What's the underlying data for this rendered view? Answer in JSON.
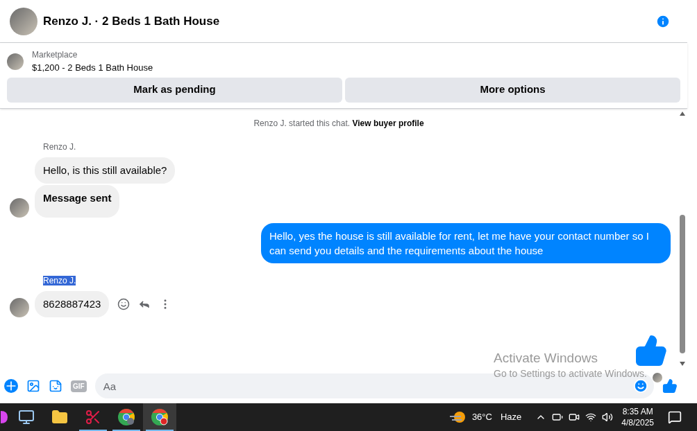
{
  "header": {
    "title": "Renzo J. · 2 Beds 1 Bath House"
  },
  "listing": {
    "source": "Marketplace",
    "title": "$1,200 - 2 Beds 1 Bath House",
    "buttons": [
      "Mark as pending",
      "More options"
    ]
  },
  "notice": {
    "text": "Renzo J. started this chat.",
    "link": "View buyer profile"
  },
  "messages": [
    {
      "kind": "incoming",
      "sender": "Renzo J.",
      "sender_selected": false,
      "texts": [
        "Hello, is this still available?",
        "Message sent"
      ],
      "actions": false
    },
    {
      "kind": "outgoing",
      "texts": [
        "Hello, yes the house is still available for rent, let me have your contact number so I can send you details and the requirements about the house"
      ]
    },
    {
      "kind": "incoming",
      "sender": "Renzo J.",
      "sender_selected": true,
      "texts": [
        "8628887423"
      ],
      "actions": true
    },
    {
      "kind": "like",
      "read": true
    }
  ],
  "composer": {
    "gif": "GIF",
    "placeholder": "Aa"
  },
  "overlay": {
    "title": "Activate Windows",
    "subtitle": "Go to Settings to activate Windows."
  },
  "taskbar": {
    "apps": [
      {
        "kind": "copilot",
        "running": false,
        "active": false
      },
      {
        "kind": "computer",
        "running": false,
        "active": false
      },
      {
        "kind": "folder",
        "running": false,
        "active": false
      },
      {
        "kind": "snip",
        "running": true,
        "active": false
      },
      {
        "kind": "chrome",
        "running": true,
        "active": false
      },
      {
        "kind": "chrome",
        "running": true,
        "active": true
      }
    ],
    "weather": {
      "temp": "36°C",
      "condition": "Haze"
    },
    "time": "8:35 AM",
    "date": "4/8/2025"
  }
}
